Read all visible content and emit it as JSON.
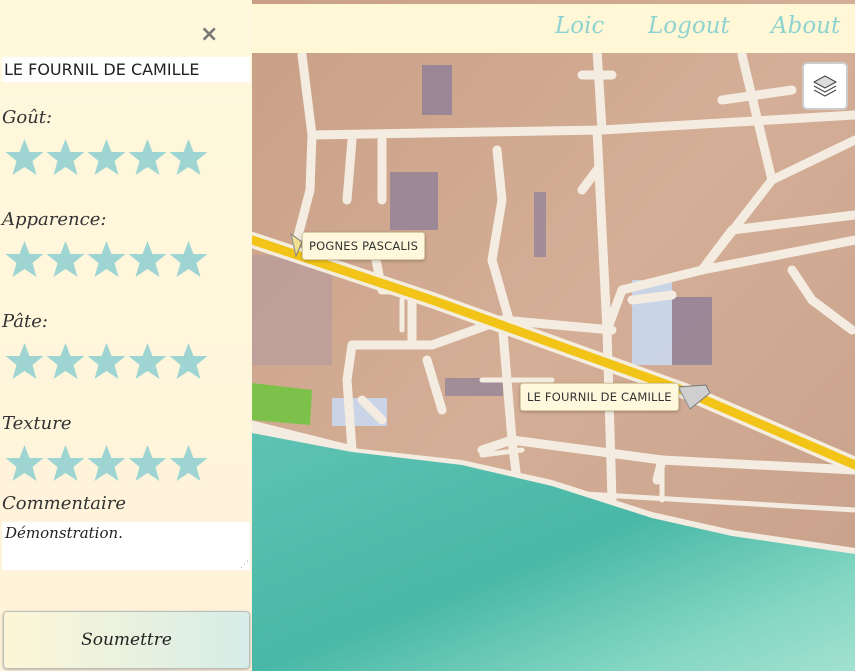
{
  "nav": {
    "user": "Loic",
    "logout": "Logout",
    "about": "About"
  },
  "panel": {
    "close": "×",
    "bakery_name": "LE FOURNIL DE CAMILLE",
    "ratings": [
      {
        "label": "Goût:",
        "stars": 5
      },
      {
        "label": "Apparence:",
        "stars": 5
      },
      {
        "label": "Pâte:",
        "stars": 5
      },
      {
        "label": "Texture",
        "stars": 5
      }
    ],
    "comment_label": "Commentaire",
    "comment_value": "Démonstration.",
    "submit": "Soumettre"
  },
  "map": {
    "markers": [
      {
        "label": "POGNES PASCALIS"
      },
      {
        "label": "LE FOURNIL DE CAMILLE"
      }
    ],
    "layers_icon": "layers-icon"
  },
  "colors": {
    "accent": "#8fd3d0",
    "star": "#9ed5d3",
    "road_main": "#f2c418"
  }
}
